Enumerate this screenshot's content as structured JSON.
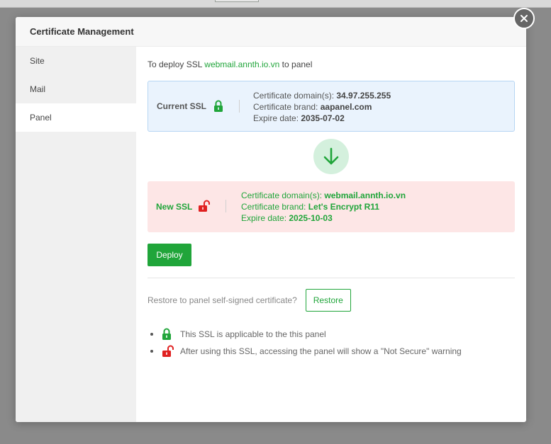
{
  "modal": {
    "title": "Certificate Management",
    "close_icon": "close-icon"
  },
  "sidebar": {
    "items": [
      {
        "label": "Site"
      },
      {
        "label": "Mail"
      },
      {
        "label": "Panel"
      }
    ],
    "active": "Panel"
  },
  "intro": {
    "prefix": "To deploy SSL ",
    "domain": "webmail.annth.io.vn",
    "suffix": " to panel"
  },
  "current_ssl": {
    "label": "Current SSL",
    "icon": "lock-closed-icon",
    "domains_label": "Certificate domain(s): ",
    "domains": "34.97.255.255",
    "brand_label": "Certificate brand: ",
    "brand": "aapanel.com",
    "expire_label": "Expire date: ",
    "expire": "2035-07-02"
  },
  "arrow_icon": "arrow-down-icon",
  "new_ssl": {
    "label": "New SSL",
    "icon": "lock-open-icon",
    "domains_label": "Certificate domain(s): ",
    "domains": "webmail.annth.io.vn",
    "brand_label": "Certificate brand: ",
    "brand": "Let's Encrypt R11",
    "expire_label": "Expire date: ",
    "expire": "2025-10-03"
  },
  "deploy_label": "Deploy",
  "restore": {
    "text": "Restore to panel self-signed certificate?",
    "button": "Restore"
  },
  "notes": [
    {
      "icon": "lock-closed-icon",
      "text": "This SSL is applicable to the this panel"
    },
    {
      "icon": "lock-open-icon",
      "text": "After using this SSL, accessing the panel will show a \"Not Secure\" warning"
    }
  ],
  "colors": {
    "accent_green": "#20a53a",
    "warning_red": "#e02020",
    "current_bg": "#eaf3fd",
    "new_bg": "#fde6e6"
  }
}
